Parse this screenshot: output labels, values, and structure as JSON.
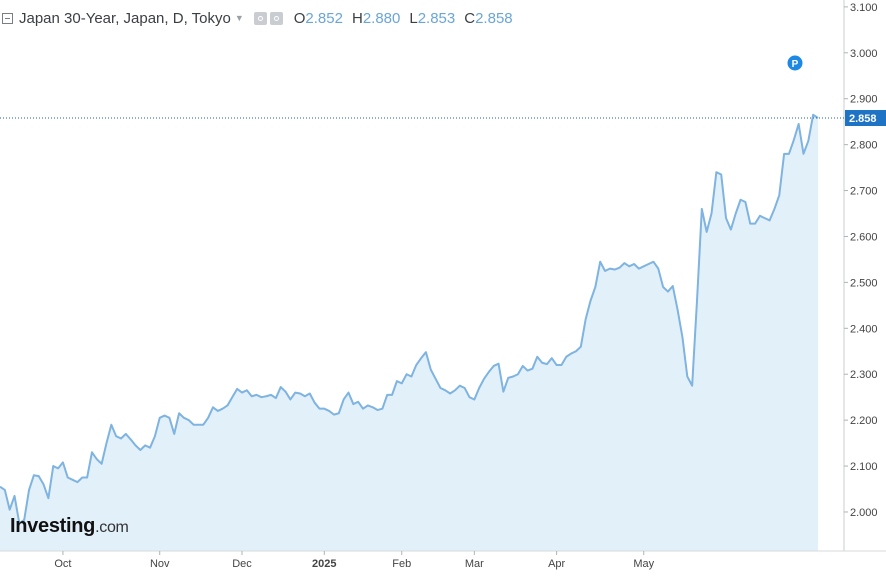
{
  "header": {
    "title": "Japan 30-Year, Japan, D, Tokyo",
    "ohlc": [
      {
        "k": "O",
        "v": "2.852"
      },
      {
        "k": "H",
        "v": "2.880"
      },
      {
        "k": "L",
        "v": "2.853"
      },
      {
        "k": "C",
        "v": "2.858"
      }
    ]
  },
  "logo": {
    "brand": "Investing",
    "domain": ".com"
  },
  "badge": {
    "label": "P"
  },
  "colors": {
    "line": "#7fb3e0",
    "fill": "#e2f0fa",
    "price_tag": "#1f73c4",
    "badge": "#1e88e5"
  },
  "chart_data": {
    "type": "area",
    "last_value_label": "2.858",
    "ylim": [
      1.915,
      3.115
    ],
    "y_ticks": [
      "2.000",
      "2.100",
      "2.200",
      "2.300",
      "2.400",
      "2.500",
      "2.600",
      "2.700",
      "2.800",
      "2.900",
      "3.000",
      "3.100"
    ],
    "x_tick_labels": [
      "Oct",
      "Nov",
      "Dec",
      "2025",
      "Feb",
      "Mar",
      "Apr",
      "May"
    ],
    "grid": false,
    "series": [
      {
        "values": [
          2.055,
          2.048,
          2.005,
          2.035,
          1.975,
          1.983,
          2.048,
          2.08,
          2.078,
          2.06,
          2.03,
          2.1,
          2.095,
          2.108,
          2.075,
          2.07,
          2.065,
          2.075,
          2.075,
          2.13,
          2.115,
          2.105,
          2.15,
          2.19,
          2.165,
          2.16,
          2.17,
          2.158,
          2.145,
          2.135,
          2.145,
          2.14,
          2.165,
          2.205,
          2.21,
          2.205,
          2.17,
          2.215,
          2.205,
          2.2,
          2.19,
          2.19,
          2.19,
          2.205,
          2.228,
          2.22,
          2.225,
          2.232,
          2.25,
          2.268,
          2.26,
          2.265,
          2.252,
          2.255,
          2.25,
          2.252,
          2.255,
          2.248,
          2.272,
          2.262,
          2.245,
          2.26,
          2.258,
          2.252,
          2.258,
          2.238,
          2.225,
          2.225,
          2.22,
          2.212,
          2.215,
          2.245,
          2.26,
          2.235,
          2.24,
          2.225,
          2.232,
          2.228,
          2.222,
          2.225,
          2.255,
          2.255,
          2.285,
          2.28,
          2.3,
          2.295,
          2.32,
          2.335,
          2.348,
          2.31,
          2.29,
          2.27,
          2.265,
          2.258,
          2.265,
          2.275,
          2.27,
          2.25,
          2.245,
          2.27,
          2.29,
          2.305,
          2.318,
          2.323,
          2.262,
          2.292,
          2.295,
          2.3,
          2.318,
          2.308,
          2.312,
          2.338,
          2.325,
          2.322,
          2.335,
          2.32,
          2.32,
          2.338,
          2.345,
          2.35,
          2.36,
          2.42,
          2.46,
          2.49,
          2.545,
          2.525,
          2.53,
          2.528,
          2.532,
          2.542,
          2.535,
          2.54,
          2.53,
          2.535,
          2.54,
          2.545,
          2.53,
          2.49,
          2.48,
          2.492,
          2.44,
          2.38,
          2.295,
          2.275,
          2.46,
          2.66,
          2.61,
          2.65,
          2.74,
          2.735,
          2.64,
          2.615,
          2.65,
          2.68,
          2.675,
          2.628,
          2.628,
          2.645,
          2.64,
          2.635,
          2.66,
          2.69,
          2.78,
          2.78,
          2.81,
          2.845,
          2.78,
          2.808,
          2.865,
          2.858
        ]
      }
    ]
  }
}
